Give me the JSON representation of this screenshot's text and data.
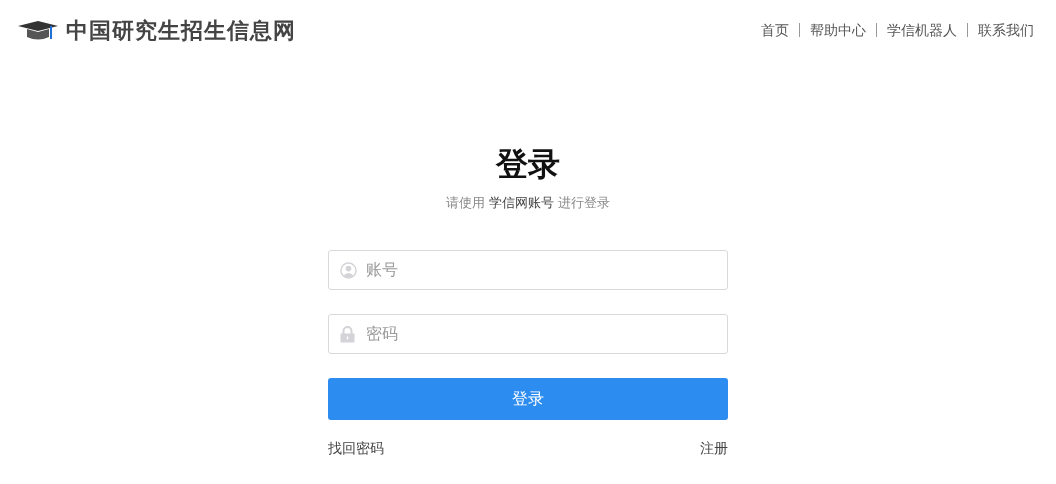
{
  "header": {
    "site_title": "中国研究生招生信息网",
    "nav": [
      "首页",
      "帮助中心",
      "学信机器人",
      "联系我们"
    ]
  },
  "login": {
    "title": "登录",
    "subtitle": {
      "before": "请使用",
      "highlight": "学信网账号",
      "after": "进行登录"
    },
    "fields": [
      {
        "kind": "user",
        "placeholder": "账号"
      },
      {
        "kind": "lock",
        "placeholder": "密码"
      }
    ],
    "submit": "登录",
    "links": [
      "找回密码",
      "注册"
    ]
  }
}
